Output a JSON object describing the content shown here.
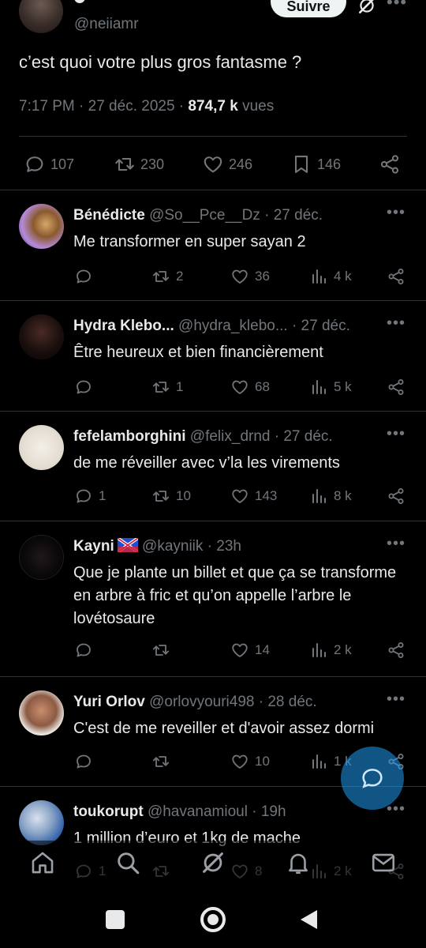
{
  "post": {
    "handle": "@neiiamr",
    "follow_label": "Suivre",
    "text": "c’est quoi votre plus gros fantasme ?",
    "time": "7:17 PM · 27 déc. 2025 · ",
    "views_count": "874,7 k",
    "views_label": " vues",
    "stats": {
      "replies": "107",
      "reposts": "230",
      "likes": "246",
      "bookmarks": "146"
    }
  },
  "replies": [
    {
      "name": "Bénédicte",
      "handle": "@So__Pce__Dz",
      "date": " · 27 déc.",
      "text": "Me transformer en super sayan 2",
      "replies": "",
      "reposts": "2",
      "likes": "36",
      "views": "4 k"
    },
    {
      "name": "Hydra Klebo...",
      "handle": "@hydra_klebo...",
      "date": " · 27 déc.",
      "text": "Être heureux et bien financièrement",
      "replies": "",
      "reposts": "1",
      "likes": "68",
      "views": "5 k"
    },
    {
      "name": "fefelamborghini",
      "handle": "@felix_drnd",
      "date": " · 27 déc.",
      "text": "de me réveiller avec v’la les virements",
      "replies": "1",
      "reposts": "10",
      "likes": "143",
      "views": "8 k"
    },
    {
      "name": "Kayni",
      "handle": "@kayniik",
      "date": " · 23h",
      "text": "Que je plante un billet et que ça se transforme en arbre à fric et qu’on appelle l’arbre le lovétosaure",
      "replies": "",
      "reposts": "",
      "likes": "14",
      "views": "2 k"
    },
    {
      "name": "Yuri Orlov",
      "handle": "@orlovyouri498",
      "date": " · 28 déc.",
      "text": "C'est de me reveiller et d'avoir assez dormi",
      "replies": "",
      "reposts": "",
      "likes": "10",
      "views": "1 k"
    },
    {
      "name": "toukorupt",
      "handle": "@havanamioul",
      "date": " · 19h",
      "text": "1 million d’euro et 1kg de mache",
      "replies": "1",
      "reposts": "",
      "likes": "8",
      "views": "2 k"
    }
  ],
  "colors": {
    "background": "#000000",
    "text": "#e7e9ea",
    "muted": "#71767b",
    "divider": "#2f3336",
    "accent": "#1d9bf0"
  },
  "icons": [
    "reply-icon",
    "repost-icon",
    "like-icon",
    "bookmark-icon",
    "share-icon",
    "views-icon",
    "more-icon",
    "grok-icon",
    "home-icon",
    "search-icon",
    "notifications-icon",
    "messages-icon",
    "compose-icon"
  ]
}
